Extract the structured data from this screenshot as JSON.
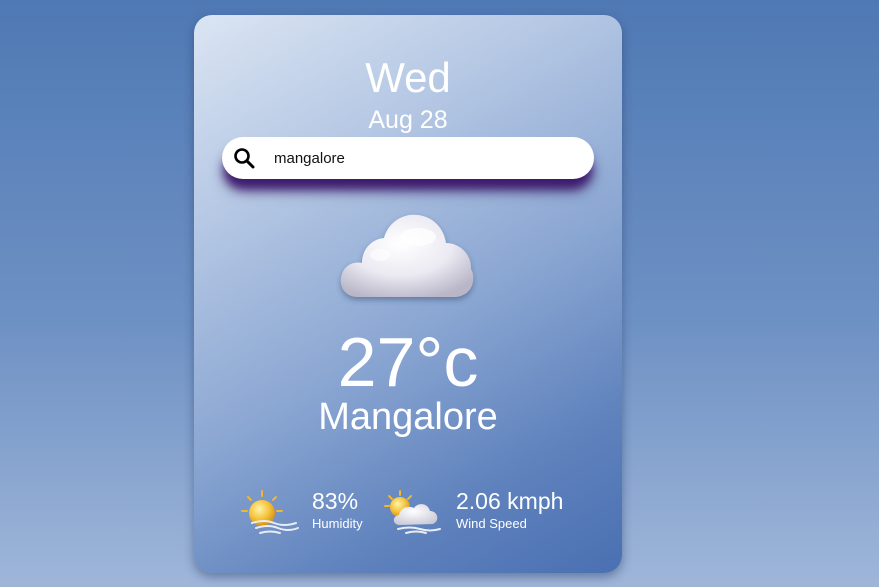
{
  "weather": {
    "day": "Wed",
    "date": "Aug 28",
    "search": {
      "value": "mangalore",
      "placeholder": ""
    },
    "condition_icon": "cloud-icon",
    "temperature": "27°c",
    "city": "Mangalore",
    "humidity": {
      "value": "83%",
      "label": "Humidity",
      "icon": "sun-humidity-icon"
    },
    "wind": {
      "value": "2.06 kmph",
      "label": "Wind Speed",
      "icon": "sun-cloud-wind-icon"
    }
  },
  "colors": {
    "page_background": "#5f85bd",
    "card_gradient_start": "#dbe5f3",
    "card_gradient_end": "#4a70b2",
    "search_shadow": "#3e1a6e",
    "text": "#ffffff"
  }
}
